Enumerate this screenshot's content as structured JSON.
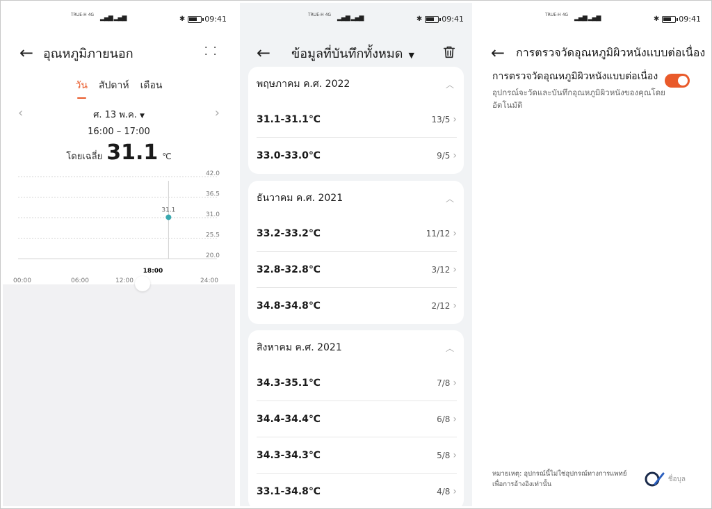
{
  "status": {
    "carrier_line1": "TRUE-H 4G",
    "time": "09:41"
  },
  "panel1": {
    "title": "อุณหภูมิภายนอก",
    "tabs": [
      "วัน",
      "สัปดาห์",
      "เดือน"
    ],
    "active_tab": 0,
    "date": "ศ. 13 พ.ค.",
    "time_range": "16:00 – 17:00",
    "avg_label": "โดยเฉลี่ย",
    "avg_value": "31.1",
    "avg_unit": "℃",
    "icons": {
      "back": "arrow-left-icon",
      "more": "four-dots-icon",
      "prev": "chevron-left-icon",
      "next": "chevron-right-icon"
    }
  },
  "chart_data": {
    "type": "scatter",
    "y_ticks": [
      "42.0",
      "36.5",
      "31.0",
      "25.5",
      "20.0"
    ],
    "ylim": [
      20.0,
      42.0
    ],
    "x_ticks": [
      "00:00",
      "06:00",
      "12:00",
      "18:00",
      "24:00"
    ],
    "xlim_hours": [
      0,
      24
    ],
    "selected_x_label": "18:00",
    "points": [
      {
        "x_hour": 16.5,
        "y": 31.1,
        "label": "31.1"
      }
    ],
    "grid": true,
    "accent_color": "#3aa9b0"
  },
  "panel2": {
    "title": "ข้อมูลที่บันทึกทั้งหมด",
    "icons": {
      "back": "arrow-left-icon",
      "dropdown": "caret-down-icon",
      "delete": "trash-icon"
    },
    "groups": [
      {
        "month": "พฤษภาคม ค.ศ. 2022",
        "rows": [
          {
            "range": "31.1-31.1℃",
            "date": "13/5"
          },
          {
            "range": "33.0-33.0℃",
            "date": "9/5"
          }
        ]
      },
      {
        "month": "ธันวาคม ค.ศ. 2021",
        "rows": [
          {
            "range": "33.2-33.2℃",
            "date": "11/12"
          },
          {
            "range": "32.8-32.8℃",
            "date": "3/12"
          },
          {
            "range": "34.8-34.8℃",
            "date": "2/12"
          }
        ]
      },
      {
        "month": "สิงหาคม ค.ศ. 2021",
        "rows": [
          {
            "range": "34.3-35.1℃",
            "date": "7/8"
          },
          {
            "range": "34.4-34.4℃",
            "date": "6/8"
          },
          {
            "range": "34.3-34.3℃",
            "date": "5/8"
          },
          {
            "range": "33.1-34.8℃",
            "date": "4/8"
          }
        ]
      }
    ]
  },
  "panel3": {
    "title": "การตรวจวัดอุณหภูมิผิวหนังแบบต่อเนื่อง",
    "setting_title": "การตรวจวัดอุณหภูมิผิวหนังแบบต่อเนื่อง",
    "setting_desc": "อุปกรณ์จะวัดและบันทึกอุณหภูมิผิวหนังของคุณโดยอัตโนมัติ",
    "toggle_on": true,
    "footnote_line1": "หมายเหตุ: อุปกรณ์นี้ไม่ใช่อุปกรณ์ทางการแพทย์",
    "footnote_line2": "เพื่อการอ้างอิงเท่านั้น",
    "watermark": "ชื่อบุล",
    "accent_color": "#e95a2a"
  }
}
